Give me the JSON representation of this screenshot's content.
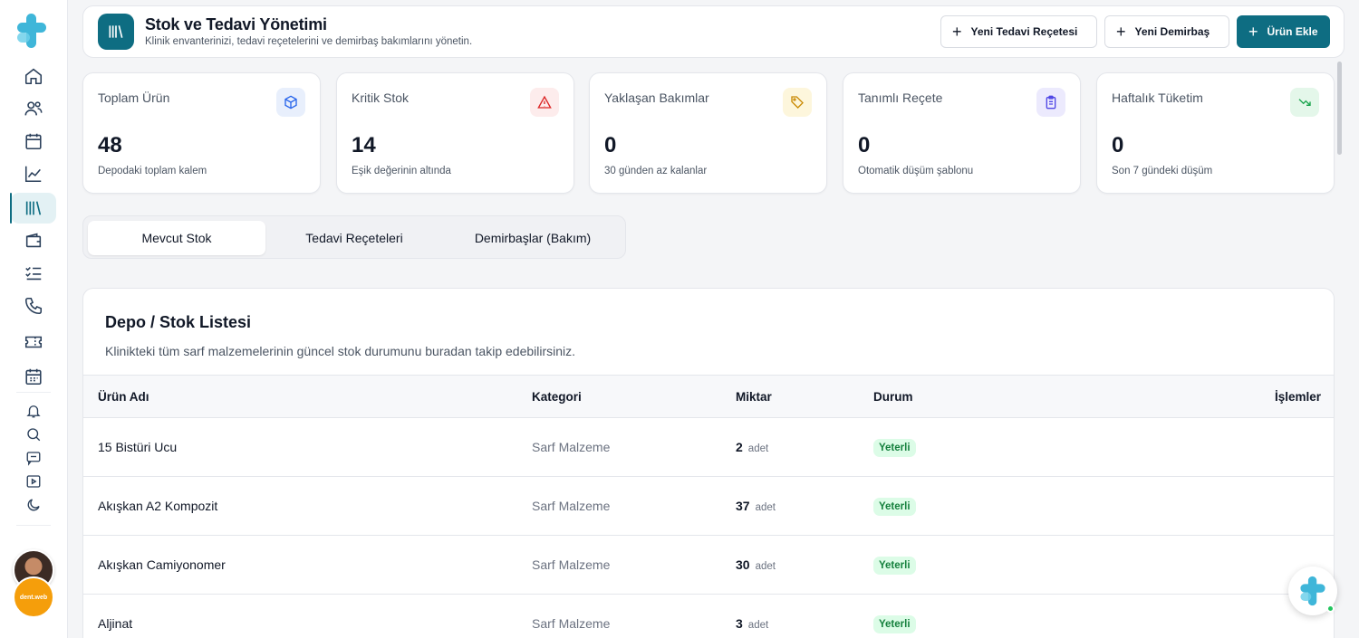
{
  "header": {
    "title": "Stok ve Tedavi Yönetimi",
    "subtitle": "Klinik envanterinizi, tedavi reçetelerini ve demirbaş bakımlarını yönetin.",
    "buttons": {
      "new_recipe": "Yeni Tedavi Reçetesi",
      "new_asset": "Yeni Demirbaş",
      "add_product": "Ürün Ekle"
    }
  },
  "stats": [
    {
      "label": "Toplam Ürün",
      "value": "48",
      "desc": "Depodaki toplam kalem",
      "icon": "box-icon",
      "color": "#2563eb"
    },
    {
      "label": "Kritik Stok",
      "value": "14",
      "desc": "Eşik değerinin altında",
      "icon": "warning-icon",
      "color": "#dc2626"
    },
    {
      "label": "Yaklaşan Bakımlar",
      "value": "0",
      "desc": "30 günden az kalanlar",
      "icon": "tag-icon",
      "color": "#ca8a04"
    },
    {
      "label": "Tanımlı Reçete",
      "value": "0",
      "desc": "Otomatik düşüm şablonu",
      "icon": "clipboard-icon",
      "color": "#4f46e5"
    },
    {
      "label": "Haftalık Tüketim",
      "value": "0",
      "desc": "Son 7 gündeki düşüm",
      "icon": "trending-down-icon",
      "color": "#16a34a"
    }
  ],
  "tabs": [
    "Mevcut Stok",
    "Tedavi Reçeteleri",
    "Demirbaşlar (Bakım)"
  ],
  "list": {
    "title": "Depo / Stok Listesi",
    "subtitle": "Klinikteki tüm sarf malzemelerinin güncel stok durumunu buradan takip edebilirsiniz.",
    "columns": [
      "Ürün Adı",
      "Kategori",
      "Miktar",
      "Durum",
      "İşlemler"
    ],
    "rows": [
      {
        "name": "15 Bistüri Ucu",
        "category": "Sarf Malzeme",
        "qty": "2",
        "unit": "adet",
        "status": "Yeterli"
      },
      {
        "name": "Akışkan A2 Kompozit",
        "category": "Sarf Malzeme",
        "qty": "37",
        "unit": "adet",
        "status": "Yeterli"
      },
      {
        "name": "Akışkan Camiyonomer",
        "category": "Sarf Malzeme",
        "qty": "30",
        "unit": "adet",
        "status": "Yeterli"
      },
      {
        "name": "Aljinat",
        "category": "Sarf Malzeme",
        "qty": "3",
        "unit": "adet",
        "status": "Yeterli"
      }
    ]
  },
  "sidebar": {
    "items": [
      "home-icon",
      "users-icon",
      "calendar-icon",
      "chart-icon",
      "inventory-icon",
      "wallet-icon",
      "checklist-icon",
      "phone-icon",
      "ticket-icon",
      "calendar-grid-icon"
    ],
    "small_items": [
      "bell-icon",
      "search-icon",
      "message-icon",
      "video-icon",
      "moon-icon"
    ],
    "brand_badge": "dent.web"
  }
}
